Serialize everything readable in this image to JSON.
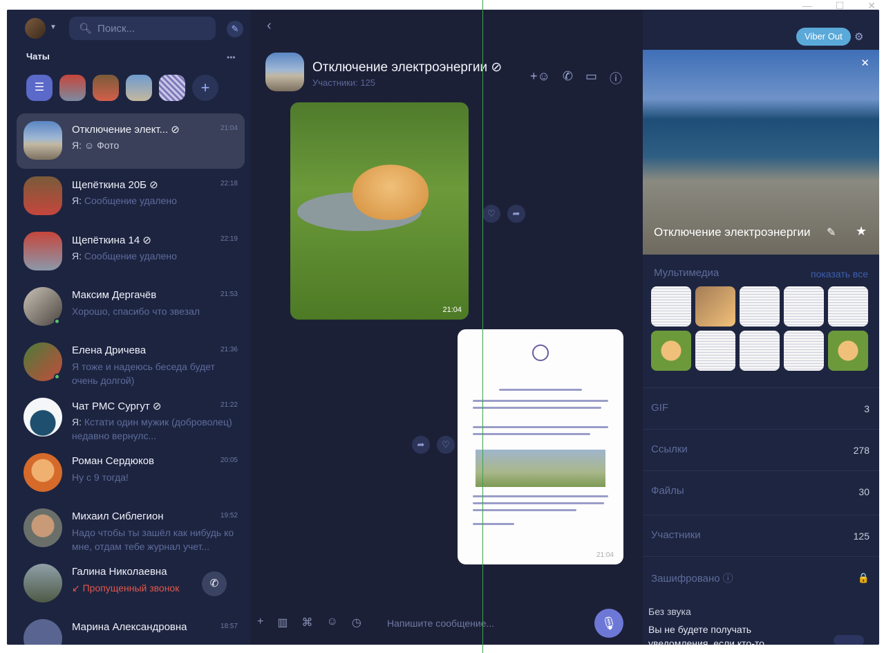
{
  "window": {
    "minimize": "—",
    "maximize": "☐",
    "close": "✕"
  },
  "sidebar": {
    "search_placeholder": "Поиск...",
    "chats_title": "Чаты",
    "more": "•••",
    "chats": [
      {
        "name": "Отключение элект... ⊘",
        "time": "21:04",
        "me": "Я:",
        "preview": "☺ Фото",
        "active": true
      },
      {
        "name": "Щепёткина 20Б ⊘",
        "time": "22:18",
        "me": "Я:",
        "preview": "Сообщение удалено"
      },
      {
        "name": "Щепёткина 14 ⊘",
        "time": "22:19",
        "me": "Я:",
        "preview": "Сообщение удалено"
      },
      {
        "name": "Максим Дергачёв",
        "time": "21:53",
        "me": "",
        "preview": "Хорошо, спасибо что звезал",
        "online": true
      },
      {
        "name": "Елена Дричева",
        "time": "21:36",
        "me": "",
        "preview": "Я тоже и надеюсь беседа будет очень долгой)",
        "online": true
      },
      {
        "name": "Чат РМС Сургут ⊘",
        "time": "21:22",
        "me": "Я:",
        "preview": "Кстати один мужик (доброволец) недавно вернулс..."
      },
      {
        "name": "Роман Сердюков",
        "time": "20:05",
        "me": "",
        "preview": "Ну с 9 тогда!"
      },
      {
        "name": "Михаил Сиблегион",
        "time": "19:52",
        "me": "",
        "preview": "Надо чтобы ты зашёл как нибудь ко мне, отдам тебе журнал учет..."
      },
      {
        "name": "Галина Николаевна",
        "time": "",
        "me": "",
        "preview": "↙ Пропущенный звонок",
        "missed": true
      },
      {
        "name": "Марина Александровна",
        "time": "18:57",
        "me": "",
        "preview": ""
      }
    ]
  },
  "conversation": {
    "title": "Отключение электроэнергии ⊘",
    "subtitle": "Участники: 125",
    "photo_time": "21:04",
    "doc_time": "21:04",
    "composer_placeholder": "Напишите сообщение..."
  },
  "info": {
    "viber_out": "Viber Out",
    "group_title": "Отключение электроэнергии",
    "media_title": "Мультимедиа",
    "show_all": "показать все",
    "rows": [
      {
        "label": "GIF",
        "value": "3"
      },
      {
        "label": "Ссылки",
        "value": "278"
      },
      {
        "label": "Файлы",
        "value": "30"
      },
      {
        "label": "Участники",
        "value": "125"
      },
      {
        "label": "Зашифровано ⓘ",
        "value": "🔒"
      }
    ],
    "mute_title": "Без звука",
    "mute_desc": "Вы не будете получать уведомления, если кто-то оценил"
  }
}
